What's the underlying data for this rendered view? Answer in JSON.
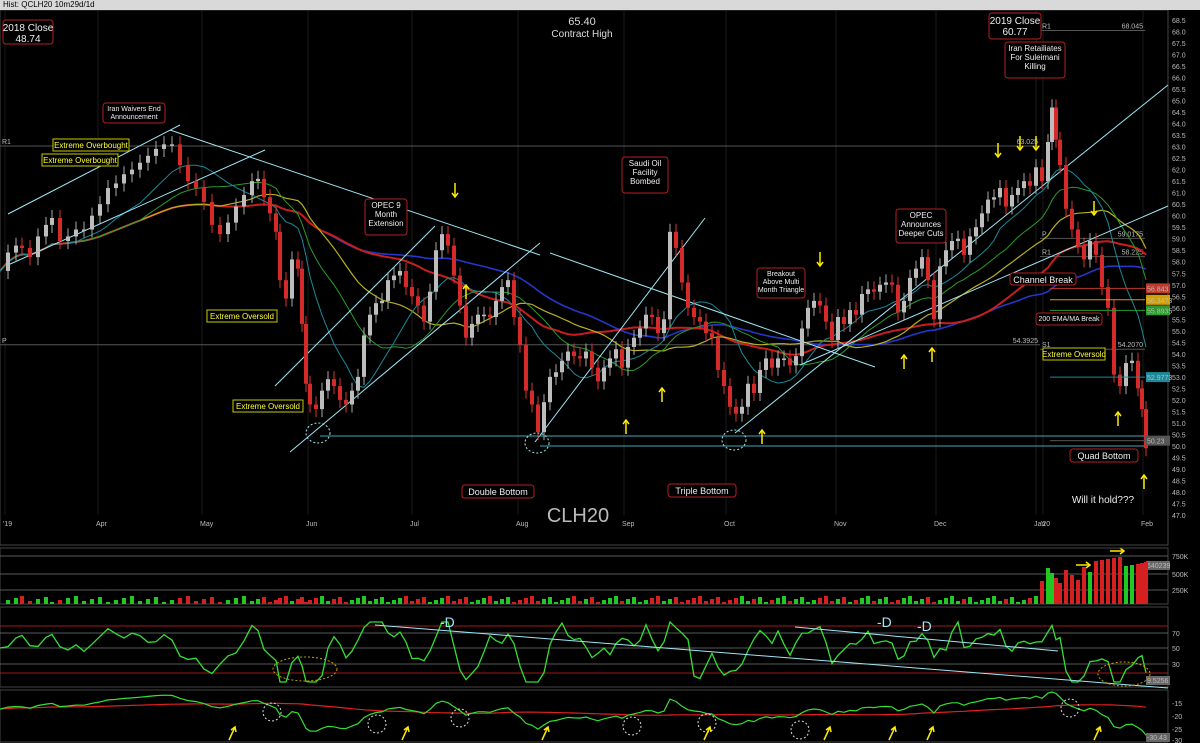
{
  "window": {
    "title": "Hist: QCLH20 10m29d/1d"
  },
  "chart_data": [
    {
      "type": "candlestick",
      "symbol_label": "CLH20",
      "title": "65.40",
      "subtitle": "Contract High",
      "y_ticks": [
        47.0,
        47.5,
        48.0,
        48.5,
        49.0,
        49.5,
        50.0,
        50.5,
        51.0,
        51.5,
        52.0,
        52.5,
        53.0,
        53.5,
        54.0,
        54.5,
        55.0,
        55.5,
        56.0,
        56.5,
        57.0,
        57.5,
        58.0,
        58.5,
        59.0,
        59.5,
        60.0,
        60.5,
        61.0,
        61.5,
        62.0,
        62.5,
        63.0,
        63.5,
        64.0,
        64.5,
        65.0,
        65.5,
        66.0,
        66.5,
        67.0,
        67.5,
        68.0,
        68.5
      ],
      "ylim": [
        46.8,
        68.6
      ],
      "x_ticks": [
        "'19",
        "Apr",
        "May",
        "Jun",
        "Jul",
        "Aug",
        "Sep",
        "Oct",
        "Nov",
        "Dec",
        "Jan",
        "'20",
        "Feb"
      ],
      "price_path": [
        [
          0,
          57.6
        ],
        [
          8,
          58.4
        ],
        [
          16,
          58.7
        ],
        [
          22,
          58.6
        ],
        [
          30,
          58.2
        ],
        [
          38,
          59.1
        ],
        [
          46,
          59.6
        ],
        [
          52,
          59.9
        ],
        [
          60,
          58.9
        ],
        [
          68,
          59.1
        ],
        [
          76,
          59.4
        ],
        [
          84,
          59.4
        ],
        [
          92,
          60.0
        ],
        [
          100,
          60.5
        ],
        [
          108,
          61.2
        ],
        [
          116,
          61.4
        ],
        [
          124,
          61.8
        ],
        [
          132,
          62.0
        ],
        [
          140,
          62.3
        ],
        [
          148,
          62.6
        ],
        [
          156,
          62.9
        ],
        [
          164,
          63.1
        ],
        [
          172,
          63.1
        ],
        [
          180,
          62.2
        ],
        [
          188,
          61.5
        ],
        [
          196,
          61.2
        ],
        [
          204,
          60.6
        ],
        [
          212,
          59.6
        ],
        [
          220,
          59.2
        ],
        [
          228,
          59.7
        ],
        [
          236,
          60.4
        ],
        [
          244,
          60.9
        ],
        [
          252,
          61.5
        ],
        [
          258,
          61.6
        ],
        [
          264,
          60.8
        ],
        [
          270,
          60.1
        ],
        [
          276,
          59.3
        ],
        [
          280,
          57.2
        ],
        [
          286,
          56.4
        ],
        [
          292,
          58.1
        ],
        [
          298,
          57.7
        ],
        [
          302,
          55.3
        ],
        [
          306,
          52.7
        ],
        [
          310,
          51.8
        ],
        [
          316,
          51.6
        ],
        [
          322,
          52.4
        ],
        [
          328,
          52.9
        ],
        [
          334,
          52.6
        ],
        [
          340,
          52.0
        ],
        [
          346,
          51.8
        ],
        [
          352,
          52.4
        ],
        [
          358,
          53.0
        ],
        [
          364,
          54.8
        ],
        [
          370,
          55.7
        ],
        [
          376,
          56.2
        ],
        [
          382,
          56.3
        ],
        [
          388,
          57.2
        ],
        [
          394,
          57.4
        ],
        [
          400,
          57.6
        ],
        [
          406,
          56.9
        ],
        [
          412,
          56.5
        ],
        [
          418,
          56.1
        ],
        [
          424,
          55.4
        ],
        [
          430,
          56.7
        ],
        [
          436,
          58.5
        ],
        [
          442,
          59.2
        ],
        [
          448,
          58.7
        ],
        [
          454,
          57.4
        ],
        [
          460,
          56.1
        ],
        [
          466,
          54.7
        ],
        [
          472,
          55.3
        ],
        [
          478,
          55.7
        ],
        [
          484,
          55.7
        ],
        [
          490,
          55.6
        ],
        [
          496,
          56.3
        ],
        [
          502,
          56.9
        ],
        [
          508,
          57.2
        ],
        [
          514,
          55.6
        ],
        [
          520,
          54.4
        ],
        [
          526,
          52.4
        ],
        [
          532,
          51.8
        ],
        [
          538,
          50.6
        ],
        [
          544,
          51.9
        ],
        [
          550,
          53.0
        ],
        [
          556,
          53.2
        ],
        [
          562,
          53.7
        ],
        [
          568,
          54.1
        ],
        [
          574,
          53.9
        ],
        [
          580,
          53.8
        ],
        [
          586,
          54.1
        ],
        [
          592,
          53.4
        ],
        [
          598,
          52.8
        ],
        [
          604,
          53.4
        ],
        [
          610,
          53.8
        ],
        [
          616,
          54.2
        ],
        [
          622,
          53.4
        ],
        [
          628,
          54.3
        ],
        [
          634,
          54.7
        ],
        [
          640,
          55.1
        ],
        [
          646,
          55.7
        ],
        [
          652,
          55.6
        ],
        [
          658,
          54.9
        ],
        [
          664,
          55.5
        ],
        [
          670,
          59.3
        ],
        [
          676,
          58.6
        ],
        [
          682,
          57.1
        ],
        [
          688,
          56.0
        ],
        [
          694,
          55.6
        ],
        [
          700,
          55.4
        ],
        [
          706,
          54.9
        ],
        [
          712,
          54.7
        ],
        [
          718,
          53.3
        ],
        [
          724,
          52.6
        ],
        [
          730,
          51.7
        ],
        [
          736,
          51.4
        ],
        [
          742,
          51.7
        ],
        [
          748,
          52.7
        ],
        [
          754,
          52.3
        ],
        [
          760,
          53.3
        ],
        [
          766,
          53.8
        ],
        [
          772,
          53.4
        ],
        [
          778,
          53.8
        ],
        [
          784,
          53.8
        ],
        [
          790,
          53.5
        ],
        [
          796,
          53.9
        ],
        [
          802,
          55.1
        ],
        [
          808,
          56.0
        ],
        [
          814,
          56.3
        ],
        [
          820,
          56.1
        ],
        [
          826,
          55.4
        ],
        [
          832,
          54.6
        ],
        [
          838,
          55.6
        ],
        [
          844,
          55.3
        ],
        [
          850,
          55.9
        ],
        [
          856,
          55.7
        ],
        [
          862,
          56.6
        ],
        [
          868,
          56.8
        ],
        [
          874,
          56.7
        ],
        [
          880,
          57.0
        ],
        [
          886,
          57.1
        ],
        [
          892,
          57.0
        ],
        [
          898,
          55.8
        ],
        [
          904,
          56.3
        ],
        [
          910,
          57.3
        ],
        [
          916,
          57.7
        ],
        [
          922,
          58.2
        ],
        [
          928,
          57.2
        ],
        [
          934,
          55.5
        ],
        [
          940,
          57.8
        ],
        [
          946,
          58.5
        ],
        [
          952,
          58.9
        ],
        [
          958,
          59.0
        ],
        [
          964,
          58.3
        ],
        [
          970,
          59.1
        ],
        [
          976,
          59.5
        ],
        [
          982,
          60.1
        ],
        [
          988,
          60.7
        ],
        [
          994,
          60.8
        ],
        [
          1000,
          61.2
        ],
        [
          1006,
          60.4
        ],
        [
          1012,
          60.9
        ],
        [
          1018,
          61.2
        ],
        [
          1024,
          61.5
        ],
        [
          1030,
          61.3
        ],
        [
          1036,
          62.1
        ],
        [
          1042,
          61.5
        ],
        [
          1048,
          63.2
        ],
        [
          1052,
          64.7
        ],
        [
          1056,
          63.3
        ],
        [
          1060,
          62.2
        ],
        [
          1066,
          60.3
        ],
        [
          1072,
          59.4
        ],
        [
          1078,
          58.7
        ],
        [
          1084,
          58.1
        ],
        [
          1090,
          58.9
        ],
        [
          1096,
          58.3
        ],
        [
          1102,
          56.9
        ],
        [
          1108,
          56.0
        ],
        [
          1114,
          53.1
        ],
        [
          1120,
          52.6
        ],
        [
          1126,
          53.6
        ],
        [
          1132,
          53.7
        ],
        [
          1138,
          52.5
        ],
        [
          1142,
          51.6
        ],
        [
          1146,
          49.9
        ]
      ],
      "levels": [
        {
          "label": "R1",
          "value": 63.025,
          "tag": "63.025"
        },
        {
          "label": "P",
          "value": 54.3925,
          "tag": "54.3925"
        },
        {
          "label": "R1",
          "value": 68.045,
          "tag": "68.045"
        },
        {
          "label": "P",
          "value": 59.0175,
          "tag": "59.0175"
        },
        {
          "label": "R1",
          "value": 58.225,
          "tag": "58.225"
        },
        {
          "label": "S1",
          "value": 54.2,
          "tag": "54.2070"
        }
      ],
      "price_tags": [
        {
          "value": 56.843,
          "text": "56.843",
          "color": "#c0392b"
        },
        {
          "value": 56.347,
          "text": "56.3473",
          "color": "#d4a000"
        },
        {
          "value": 55.89,
          "text": "55.8935",
          "color": "#2a9a2a"
        },
        {
          "value": 52.99,
          "text": "52.9773",
          "color": "#1a8a9a"
        },
        {
          "value": 50.23,
          "text": "50.23",
          "color": "#555555"
        }
      ],
      "annotations": [
        {
          "text": [
            "2018 Close",
            "48.74"
          ]
        },
        {
          "text": [
            "2019 Close",
            "60.77"
          ]
        },
        {
          "text": [
            "Iran Waivers End",
            "Announcement"
          ]
        },
        {
          "text": [
            "OPEC 9",
            "Month",
            "Extension"
          ]
        },
        {
          "text": [
            "Saudi Oil",
            "Facility",
            "Bombed"
          ]
        },
        {
          "text": [
            "Breakout",
            "Above Multi",
            "Month Triangle"
          ]
        },
        {
          "text": [
            "OPEC",
            "Announces",
            "Deeper Cuts"
          ]
        },
        {
          "text": [
            "Iran Retailiates",
            "For Suleimani",
            "Killing"
          ]
        },
        {
          "text": [
            "Channel Break"
          ]
        },
        {
          "text": [
            "200 EMA/MA Break"
          ]
        },
        {
          "text": [
            "Double Bottom"
          ]
        },
        {
          "text": [
            "Triple Bottom"
          ]
        },
        {
          "text": [
            "Quad Bottom"
          ]
        }
      ],
      "yellow_labels": [
        "Extreme Overbought",
        "Extreme Overbought",
        "Extreme Oversold",
        "Extreme Oversold",
        "Extreme Oversold"
      ],
      "note_text": "Will it hold???"
    },
    {
      "type": "bar",
      "name": "Volume",
      "y_ticks": [
        "750K",
        "500K",
        "250K"
      ],
      "tag": "640239"
    },
    {
      "type": "line",
      "name": "Oscillator",
      "y_ticks": [
        "70",
        "50",
        "30"
      ],
      "tag": "9.5256",
      "divergence_labels": [
        "-D",
        "-D",
        "-D"
      ]
    },
    {
      "type": "line",
      "name": "Momentum",
      "y_ticks": [
        "-15",
        "-20",
        "-25",
        "-30"
      ],
      "tag": "-30.43"
    }
  ]
}
